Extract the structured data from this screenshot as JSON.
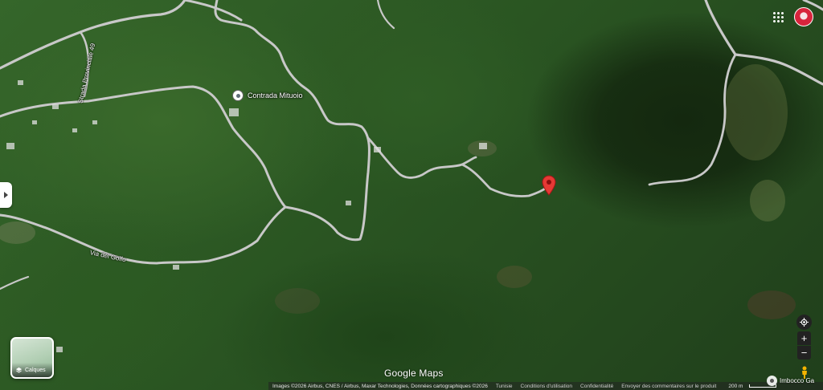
{
  "map": {
    "poi": {
      "label": "Contrada Mituoio",
      "icon": "place-pin-icon"
    },
    "roads": [
      {
        "label": "Strada Provinciale 49"
      },
      {
        "label": "Via del Golfo"
      }
    ],
    "marker": {
      "icon": "red-location-marker-icon",
      "color": "#e53935"
    }
  },
  "header": {
    "apps_icon": "apps-grid-icon",
    "account_icon": "account-avatar-icon"
  },
  "controls": {
    "layers_label": "Calques",
    "locate_icon": "my-location-icon",
    "zoom_in": "+",
    "zoom_out": "−",
    "pegman_icon": "street-view-pegman-icon",
    "side_toggle_icon": "expand-panel-icon"
  },
  "branding": {
    "logo": "Google Maps"
  },
  "footer": {
    "attribution": "Images ©2026 Airbus, CNES / Airbus, Maxar Technologies, Données cartographiques ©2026",
    "region": "Tunisie",
    "terms": "Conditions d'utilisation",
    "privacy": "Confidentialité",
    "feedback": "Envoyer des commentaires sur le produit",
    "scale": "200 m"
  },
  "nearby_place": {
    "label": "Imbocco Ga"
  },
  "colors": {
    "road": "#c8c8c8",
    "marker": "#e53935",
    "control_bg": "#222222"
  }
}
